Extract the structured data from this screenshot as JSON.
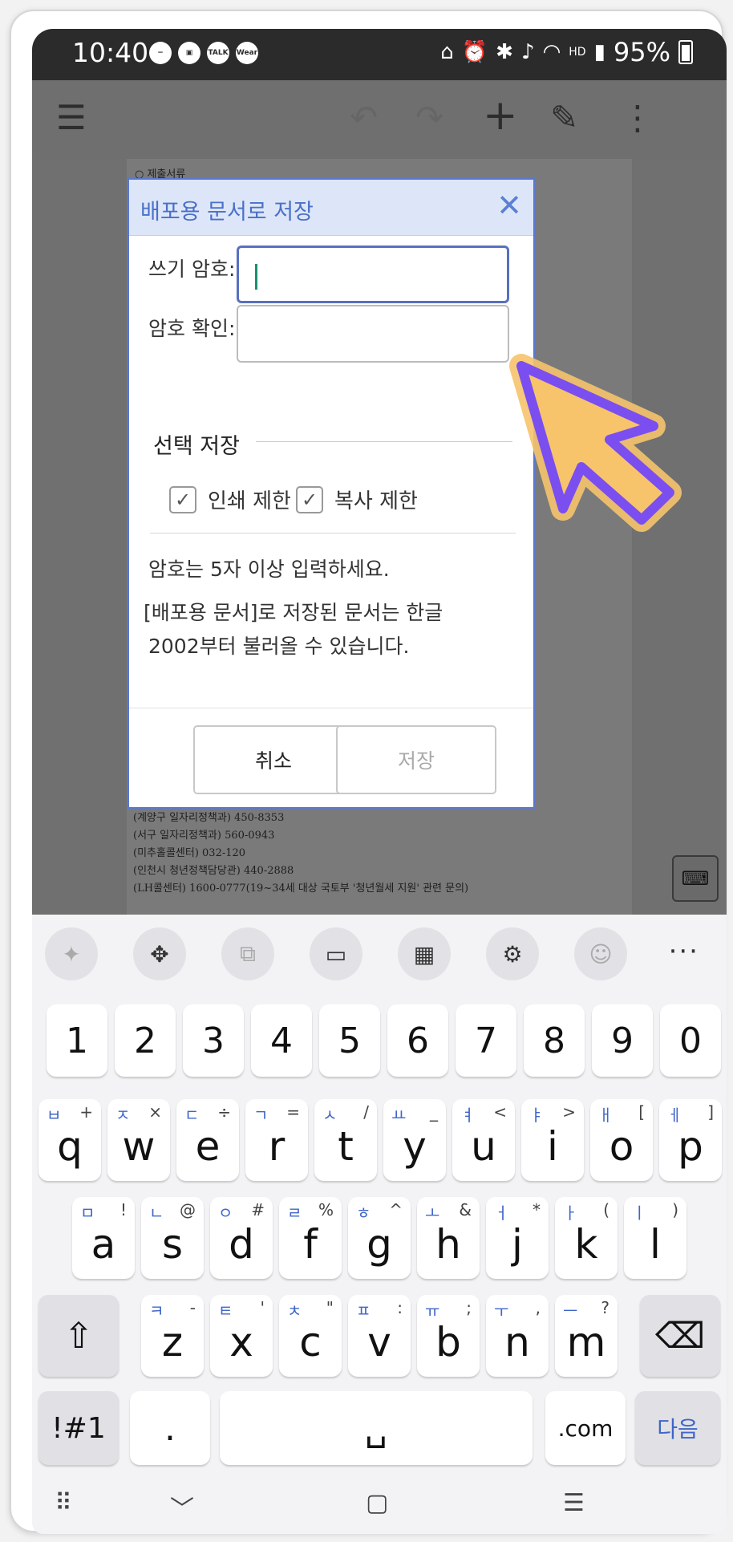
{
  "status_bar": {
    "time": "10:40",
    "battery": "95%",
    "notif_icons": [
      "−",
      "▣",
      "TALK",
      "Wear"
    ],
    "right_icons": [
      "bed-icon",
      "alarm-icon",
      "bluetooth-icon",
      "mute-icon",
      "wifi-icon",
      "HD",
      "signal-icon"
    ]
  },
  "toolbar": {
    "menu": "☰",
    "undo": "↶",
    "redo": "↷",
    "add": "+",
    "edit": "✎",
    "more": "⋮"
  },
  "document": {
    "top_line": "○ 제출서류",
    "bottom_lines": [
      "(계양구 일자리정책과) 450-8353",
      "(서구 일자리정책과) 560-0943",
      "(미추홀콜센터) 032-120",
      "(인천시 청년정책담당관) 440-2888",
      "(LH콜센터) 1600-0777(19~34세 대상 국토부 '청년월세 지원' 관련 문의)"
    ]
  },
  "dialog": {
    "title": "배포용 문서로 저장",
    "close": "✕",
    "write_password_label": "쓰기 암호:",
    "confirm_password_label": "암호 확인:",
    "options_title": "선택 저장",
    "print_restrict": "인쇄 제한",
    "copy_restrict": "복사 제한",
    "check_mark": "✓",
    "hint": "암호는 5자 이상 입력하세요.",
    "note_line1": "[배포용 문서]로 저장된 문서는 한글",
    "note_line2": "2002부터 불러올 수 있습니다.",
    "cancel": "취소",
    "save": "저장"
  },
  "keyboard": {
    "number_row": [
      "1",
      "2",
      "3",
      "4",
      "5",
      "6",
      "7",
      "8",
      "9",
      "0"
    ],
    "row1": [
      {
        "k": "q",
        "h": "ㅂ",
        "s": "+"
      },
      {
        "k": "w",
        "h": "ㅈ",
        "s": "×"
      },
      {
        "k": "e",
        "h": "ㄷ",
        "s": "÷"
      },
      {
        "k": "r",
        "h": "ㄱ",
        "s": "="
      },
      {
        "k": "t",
        "h": "ㅅ",
        "s": "/"
      },
      {
        "k": "y",
        "h": "ㅛ",
        "s": "_"
      },
      {
        "k": "u",
        "h": "ㅕ",
        "s": "<"
      },
      {
        "k": "i",
        "h": "ㅑ",
        "s": ">"
      },
      {
        "k": "o",
        "h": "ㅐ",
        "s": "["
      },
      {
        "k": "p",
        "h": "ㅔ",
        "s": "]"
      }
    ],
    "row2": [
      {
        "k": "a",
        "h": "ㅁ",
        "s": "!"
      },
      {
        "k": "s",
        "h": "ㄴ",
        "s": "@"
      },
      {
        "k": "d",
        "h": "ㅇ",
        "s": "#"
      },
      {
        "k": "f",
        "h": "ㄹ",
        "s": "%"
      },
      {
        "k": "g",
        "h": "ㅎ",
        "s": "^"
      },
      {
        "k": "h",
        "h": "ㅗ",
        "s": "&"
      },
      {
        "k": "j",
        "h": "ㅓ",
        "s": "*"
      },
      {
        "k": "k",
        "h": "ㅏ",
        "s": "("
      },
      {
        "k": "l",
        "h": "ㅣ",
        "s": ")"
      }
    ],
    "row3": [
      {
        "k": "z",
        "h": "ㅋ",
        "s": "-"
      },
      {
        "k": "x",
        "h": "ㅌ",
        "s": "'"
      },
      {
        "k": "c",
        "h": "ㅊ",
        "s": "\""
      },
      {
        "k": "v",
        "h": "ㅍ",
        "s": ":"
      },
      {
        "k": "b",
        "h": "ㅠ",
        "s": ";"
      },
      {
        "k": "n",
        "h": "ㅜ",
        "s": ","
      },
      {
        "k": "m",
        "h": "ㅡ",
        "s": "?"
      }
    ],
    "symbols": "!#1",
    "period": ".",
    "dotcom": ".com",
    "next": "다음",
    "shift": "⇧",
    "backspace": "⌫",
    "space": "␣"
  },
  "nav": {
    "kb_switch": "⠿",
    "hide": "﹀",
    "home": "▢",
    "recents": "☰"
  },
  "colors": {
    "accent": "#4a70c8",
    "cursor_fill": "#f7c46c",
    "cursor_stroke": "#7b4ef0"
  }
}
